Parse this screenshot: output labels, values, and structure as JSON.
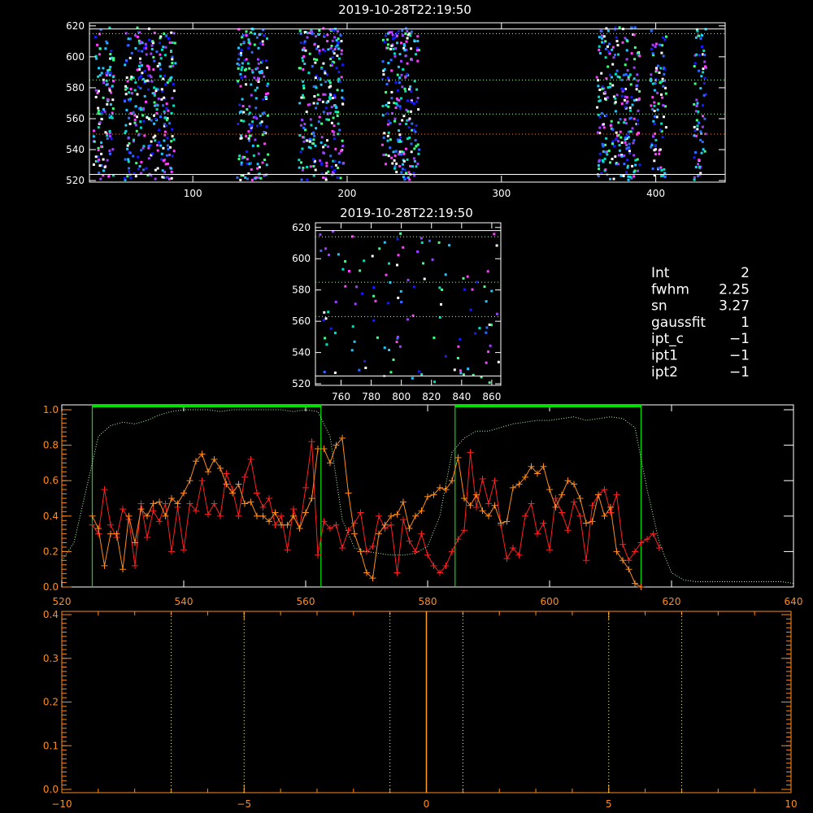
{
  "colors": {
    "white": "#ffffff",
    "orange": "#ff8c1a",
    "red": "#ff2020",
    "green": "#00e000",
    "lightgreen": "#b4ffb4",
    "yellow": "#ffffa0",
    "spectrum_orange": "#ffa020"
  },
  "info": {
    "lines": [
      {
        "label": "Int",
        "value": "2"
      },
      {
        "label": "fwhm",
        "value": "2.25"
      },
      {
        "label": "sn",
        "value": "3.27"
      },
      {
        "label": "gaussfit",
        "value": "1"
      },
      {
        "label": "ipt_c",
        "value": "−1"
      },
      {
        "label": "ipt1",
        "value": "−1"
      },
      {
        "label": "ipt2",
        "value": "−1"
      }
    ]
  },
  "chart_data": [
    {
      "id": "top-image",
      "type": "heatmap",
      "title": "2019-10-28T22:19:50",
      "xlim": [
        33,
        445
      ],
      "ylim": [
        519,
        622
      ],
      "xticks": [
        100,
        200,
        300,
        400
      ],
      "yticks": [
        520,
        540,
        560,
        580,
        600,
        620
      ],
      "hlines": [
        {
          "y": 618,
          "style": "solid",
          "color": "white"
        },
        {
          "y": 524,
          "style": "solid",
          "color": "white"
        },
        {
          "y": 615,
          "style": "dotted",
          "color": "lightgreen"
        },
        {
          "y": 585,
          "style": "dotted",
          "color": "lightgreen"
        },
        {
          "y": 563,
          "style": "dotted",
          "color": "lightgreen"
        },
        {
          "y": 550,
          "style": "dotted",
          "color": "orange"
        }
      ],
      "pixel_columns": [
        [
          35,
          48
        ],
        [
          55,
          88
        ],
        [
          128,
          148
        ],
        [
          168,
          197
        ],
        [
          222,
          246
        ],
        [
          361,
          389
        ],
        [
          396,
          406
        ],
        [
          424,
          432
        ]
      ]
    },
    {
      "id": "zoom-image",
      "type": "heatmap",
      "title": "2019-10-28T22:19:50",
      "xlim": [
        743,
        866
      ],
      "ylim": [
        519,
        623
      ],
      "xticks": [
        760,
        780,
        800,
        820,
        840,
        860
      ],
      "yticks": [
        520,
        540,
        560,
        580,
        600,
        620
      ],
      "hlines": [
        {
          "y": 618,
          "style": "solid",
          "color": "white"
        },
        {
          "y": 525,
          "style": "solid",
          "color": "white"
        },
        {
          "y": 614,
          "style": "dotted",
          "color": "lightgreen"
        },
        {
          "y": 585,
          "style": "dotted",
          "color": "lightgreen"
        },
        {
          "y": 563,
          "style": "dotted",
          "color": "lightgreen"
        }
      ]
    },
    {
      "id": "profile",
      "type": "line",
      "xlim": [
        520,
        640
      ],
      "ylim": [
        0,
        1.0
      ],
      "xticks": [
        520,
        540,
        560,
        580,
        600,
        620,
        640
      ],
      "yticks": [
        0.0,
        0.2,
        0.4,
        0.6,
        0.8,
        1.0
      ],
      "ytick_labels": [
        "0.0",
        "0.2",
        "0.4",
        "0.6",
        "0.8",
        "1.0"
      ],
      "green_windows": [
        [
          525,
          562.5
        ],
        [
          584.5,
          615
        ]
      ],
      "series": [
        {
          "color": "red",
          "x": [
            525,
            526,
            527,
            528,
            529,
            530,
            531,
            532,
            533,
            534,
            535,
            536,
            537,
            538,
            539,
            540,
            541,
            542,
            543,
            544,
            545,
            546,
            547,
            548,
            549,
            550,
            551,
            552,
            553,
            554,
            555,
            556,
            557,
            558,
            559,
            560,
            561,
            562,
            563,
            564,
            565,
            566,
            567,
            568,
            569,
            570,
            571,
            572,
            573,
            574,
            575,
            576,
            577,
            578,
            579,
            580,
            581,
            582,
            583,
            584,
            585,
            586,
            587,
            588,
            589,
            590,
            591,
            592,
            593,
            594,
            595,
            596,
            597,
            598,
            599,
            600,
            601,
            602,
            603,
            604,
            605,
            606,
            607,
            608,
            609,
            610,
            611,
            612,
            613,
            614,
            615,
            616,
            617,
            618
          ],
          "y": [
            0.35,
            0.3,
            0.55,
            0.35,
            0.28,
            0.44,
            0.38,
            0.12,
            0.47,
            0.28,
            0.43,
            0.37,
            0.47,
            0.2,
            0.45,
            0.21,
            0.47,
            0.43,
            0.6,
            0.41,
            0.47,
            0.4,
            0.64,
            0.55,
            0.4,
            0.62,
            0.72,
            0.53,
            0.45,
            0.5,
            0.35,
            0.4,
            0.21,
            0.44,
            0.33,
            0.56,
            0.82,
            0.18,
            0.37,
            0.33,
            0.35,
            0.22,
            0.32,
            0.36,
            0.42,
            0.2,
            0.23,
            0.4,
            0.33,
            0.35,
            0.08,
            0.38,
            0.26,
            0.2,
            0.3,
            0.18,
            0.12,
            0.08,
            0.12,
            0.2,
            0.27,
            0.32,
            0.76,
            0.45,
            0.61,
            0.47,
            0.6,
            0.35,
            0.16,
            0.22,
            0.18,
            0.4,
            0.47,
            0.3,
            0.36,
            0.21,
            0.5,
            0.42,
            0.32,
            0.48,
            0.4,
            0.15,
            0.46,
            0.52,
            0.55,
            0.42,
            0.52,
            0.24,
            0.15,
            0.2,
            0.25,
            0.27,
            0.3,
            0.22
          ]
        },
        {
          "color": "orange",
          "x": [
            525,
            526,
            527,
            528,
            529,
            530,
            531,
            532,
            533,
            534,
            535,
            536,
            537,
            538,
            539,
            540,
            541,
            542,
            543,
            544,
            545,
            546,
            547,
            548,
            549,
            550,
            551,
            552,
            553,
            554,
            555,
            556,
            557,
            558,
            559,
            560,
            561,
            562,
            563,
            564,
            565,
            566,
            567,
            568,
            569,
            570,
            571,
            572,
            573,
            574,
            575,
            576,
            577,
            578,
            579,
            580,
            581,
            582,
            583,
            584,
            585,
            586,
            587,
            588,
            589,
            590,
            591,
            592,
            593,
            594,
            595,
            596,
            597,
            598,
            599,
            600,
            601,
            602,
            603,
            604,
            605,
            606,
            607,
            608,
            609,
            610,
            611,
            612,
            613,
            614,
            615
          ],
          "y": [
            0.4,
            0.33,
            0.12,
            0.3,
            0.3,
            0.1,
            0.4,
            0.25,
            0.44,
            0.4,
            0.47,
            0.48,
            0.4,
            0.5,
            0.47,
            0.53,
            0.6,
            0.71,
            0.75,
            0.65,
            0.72,
            0.67,
            0.58,
            0.53,
            0.58,
            0.47,
            0.48,
            0.4,
            0.4,
            0.37,
            0.42,
            0.35,
            0.35,
            0.4,
            0.33,
            0.42,
            0.5,
            0.78,
            0.78,
            0.7,
            0.8,
            0.84,
            0.53,
            0.3,
            0.2,
            0.08,
            0.05,
            0.3,
            0.35,
            0.4,
            0.41,
            0.48,
            0.33,
            0.4,
            0.43,
            0.51,
            0.52,
            0.56,
            0.55,
            0.6,
            0.73,
            0.5,
            0.46,
            0.52,
            0.43,
            0.4,
            0.46,
            0.36,
            0.37,
            0.56,
            0.58,
            0.62,
            0.68,
            0.64,
            0.68,
            0.55,
            0.45,
            0.52,
            0.6,
            0.58,
            0.5,
            0.36,
            0.37,
            0.52,
            0.4,
            0.45,
            0.2,
            0.15,
            0.1,
            0.02,
            0.0
          ]
        },
        {
          "color": "lightgreen",
          "style": "dotted",
          "x": [
            520,
            522,
            524,
            526,
            528,
            530,
            532,
            534,
            536,
            538,
            540,
            542,
            544,
            546,
            548,
            550,
            552,
            554,
            556,
            558,
            560,
            562,
            564,
            566,
            568,
            570,
            572,
            574,
            576,
            578,
            580,
            582,
            584,
            586,
            588,
            590,
            592,
            594,
            596,
            598,
            600,
            602,
            604,
            606,
            608,
            610,
            612,
            614,
            616,
            618,
            620,
            622,
            624,
            626,
            628,
            630,
            632,
            634,
            636,
            638,
            640
          ],
          "y": [
            0.15,
            0.25,
            0.55,
            0.85,
            0.91,
            0.93,
            0.92,
            0.94,
            0.97,
            0.99,
            1.0,
            1.0,
            1.0,
            0.99,
            1.0,
            1.0,
            1.0,
            1.0,
            1.0,
            0.99,
            1.0,
            0.99,
            0.85,
            0.38,
            0.22,
            0.2,
            0.19,
            0.18,
            0.18,
            0.19,
            0.23,
            0.4,
            0.76,
            0.84,
            0.88,
            0.88,
            0.9,
            0.92,
            0.93,
            0.94,
            0.94,
            0.95,
            0.96,
            0.94,
            0.95,
            0.96,
            0.95,
            0.9,
            0.55,
            0.25,
            0.08,
            0.04,
            0.03,
            0.03,
            0.03,
            0.03,
            0.03,
            0.03,
            0.03,
            0.03,
            0.02
          ]
        }
      ]
    },
    {
      "id": "spectrum",
      "type": "line",
      "xlim": [
        -10,
        10
      ],
      "ylim": [
        0,
        0.4
      ],
      "xticks": [
        -10,
        -5,
        0,
        5,
        10
      ],
      "xtick_labels": [
        "−10",
        "−5",
        "0",
        "5",
        "10"
      ],
      "yticks": [
        0.0,
        0.1,
        0.2,
        0.3,
        0.4
      ],
      "ytick_labels": [
        "0.0",
        "0.1",
        "0.2",
        "0.3",
        "0.4"
      ],
      "vlines_dotted": [
        -7,
        -5,
        -1,
        1,
        5,
        7
      ],
      "vline_solid": 0
    }
  ]
}
